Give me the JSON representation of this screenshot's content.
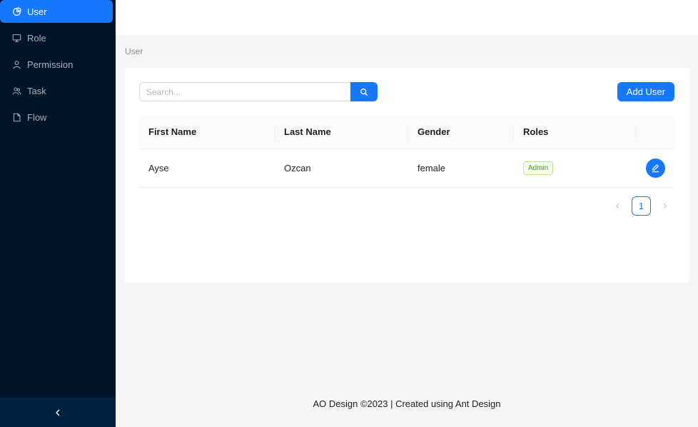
{
  "sidebar": {
    "items": [
      {
        "label": "User",
        "icon": "pie-chart-icon",
        "active": true
      },
      {
        "label": "Role",
        "icon": "desktop-icon"
      },
      {
        "label": "Permission",
        "icon": "user-icon"
      },
      {
        "label": "Task",
        "icon": "team-icon"
      },
      {
        "label": "Flow",
        "icon": "file-icon"
      }
    ],
    "collapse_icon": "left-chevron-icon"
  },
  "breadcrumb": {
    "current": "User"
  },
  "toolbar": {
    "search_placeholder": "Search...",
    "search_icon": "search-icon",
    "add_label": "Add User"
  },
  "table": {
    "columns": [
      "First Name",
      "Last Name",
      "Gender",
      "Roles",
      ""
    ],
    "rows": [
      {
        "first_name": "Ayse",
        "last_name": "Ozcan",
        "gender": "female",
        "role": "Admin"
      }
    ]
  },
  "pagination": {
    "current_page": "1"
  },
  "footer": {
    "text": "AO Design ©2023 | Created using Ant Design"
  },
  "colors": {
    "primary": "#1677ff",
    "sider": "#001529",
    "trigger": "#002140",
    "tag_green": "#389e0d"
  }
}
